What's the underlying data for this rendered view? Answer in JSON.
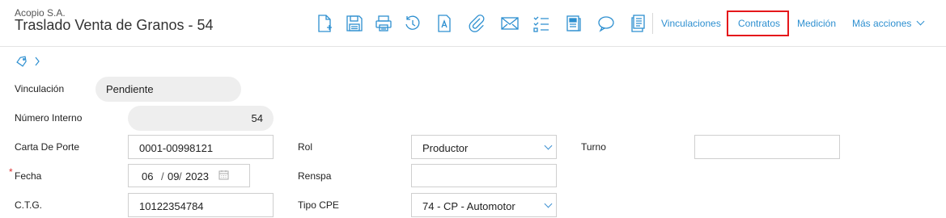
{
  "header": {
    "company": "Acopio S.A.",
    "title": "Traslado Venta de Granos - 54",
    "toolbar_icons": [
      "new-document-icon",
      "save-icon",
      "print-icon",
      "history-icon",
      "document-text-icon",
      "attachment-icon",
      "mail-icon",
      "checklist-icon",
      "notes-icon",
      "comment-icon",
      "pages-icon"
    ],
    "actions": {
      "vinculaciones": "Vinculaciones",
      "contratos": "Contratos",
      "medicion": "Medición",
      "mas_acciones": "Más acciones"
    },
    "accent_color": "#2d8fd0",
    "highlight_color": "#e5171b"
  },
  "breadcrumb": {
    "icons": [
      "tag-icon",
      "chevron-right-icon"
    ]
  },
  "form": {
    "vinculacion": {
      "label": "Vinculación",
      "value": "Pendiente"
    },
    "numero_interno": {
      "label": "Número Interno",
      "value": "54"
    },
    "carta_de_porte": {
      "label": "Carta De Porte",
      "value": "0001-00998121"
    },
    "fecha": {
      "label": "Fecha",
      "required_mark": "*",
      "day": "06",
      "sep1": "/",
      "month": "09",
      "sep2": "/",
      "year": "2023"
    },
    "ctg": {
      "label": "C.T.G.",
      "value": "10122354784"
    },
    "rol": {
      "label": "Rol",
      "value": "Productor"
    },
    "renspa": {
      "label": "Renspa",
      "value": ""
    },
    "tipo_cpe": {
      "label": "Tipo CPE",
      "value": "74 - CP - Automotor"
    },
    "turno": {
      "label": "Turno",
      "value": ""
    }
  }
}
